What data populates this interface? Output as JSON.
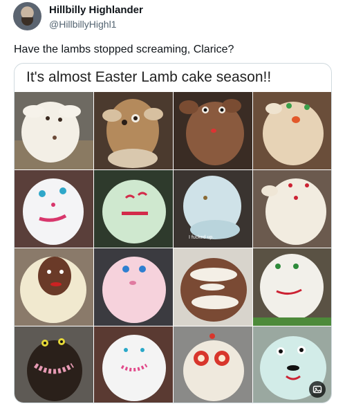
{
  "tweet": {
    "author_name": "Hillbilly Highlander",
    "author_handle": "@HillbillyHighl1",
    "text": "Have the lambs stopped screaming, Clarice?"
  },
  "media": {
    "title": "It's almost Easter Lamb cake season!!",
    "overlay_caption": "I fucked up.",
    "icons": [
      "image-badge-icon"
    ]
  },
  "colors": {
    "text_primary": "#0f1419",
    "text_secondary": "#536471",
    "border": "#cfd9de"
  }
}
